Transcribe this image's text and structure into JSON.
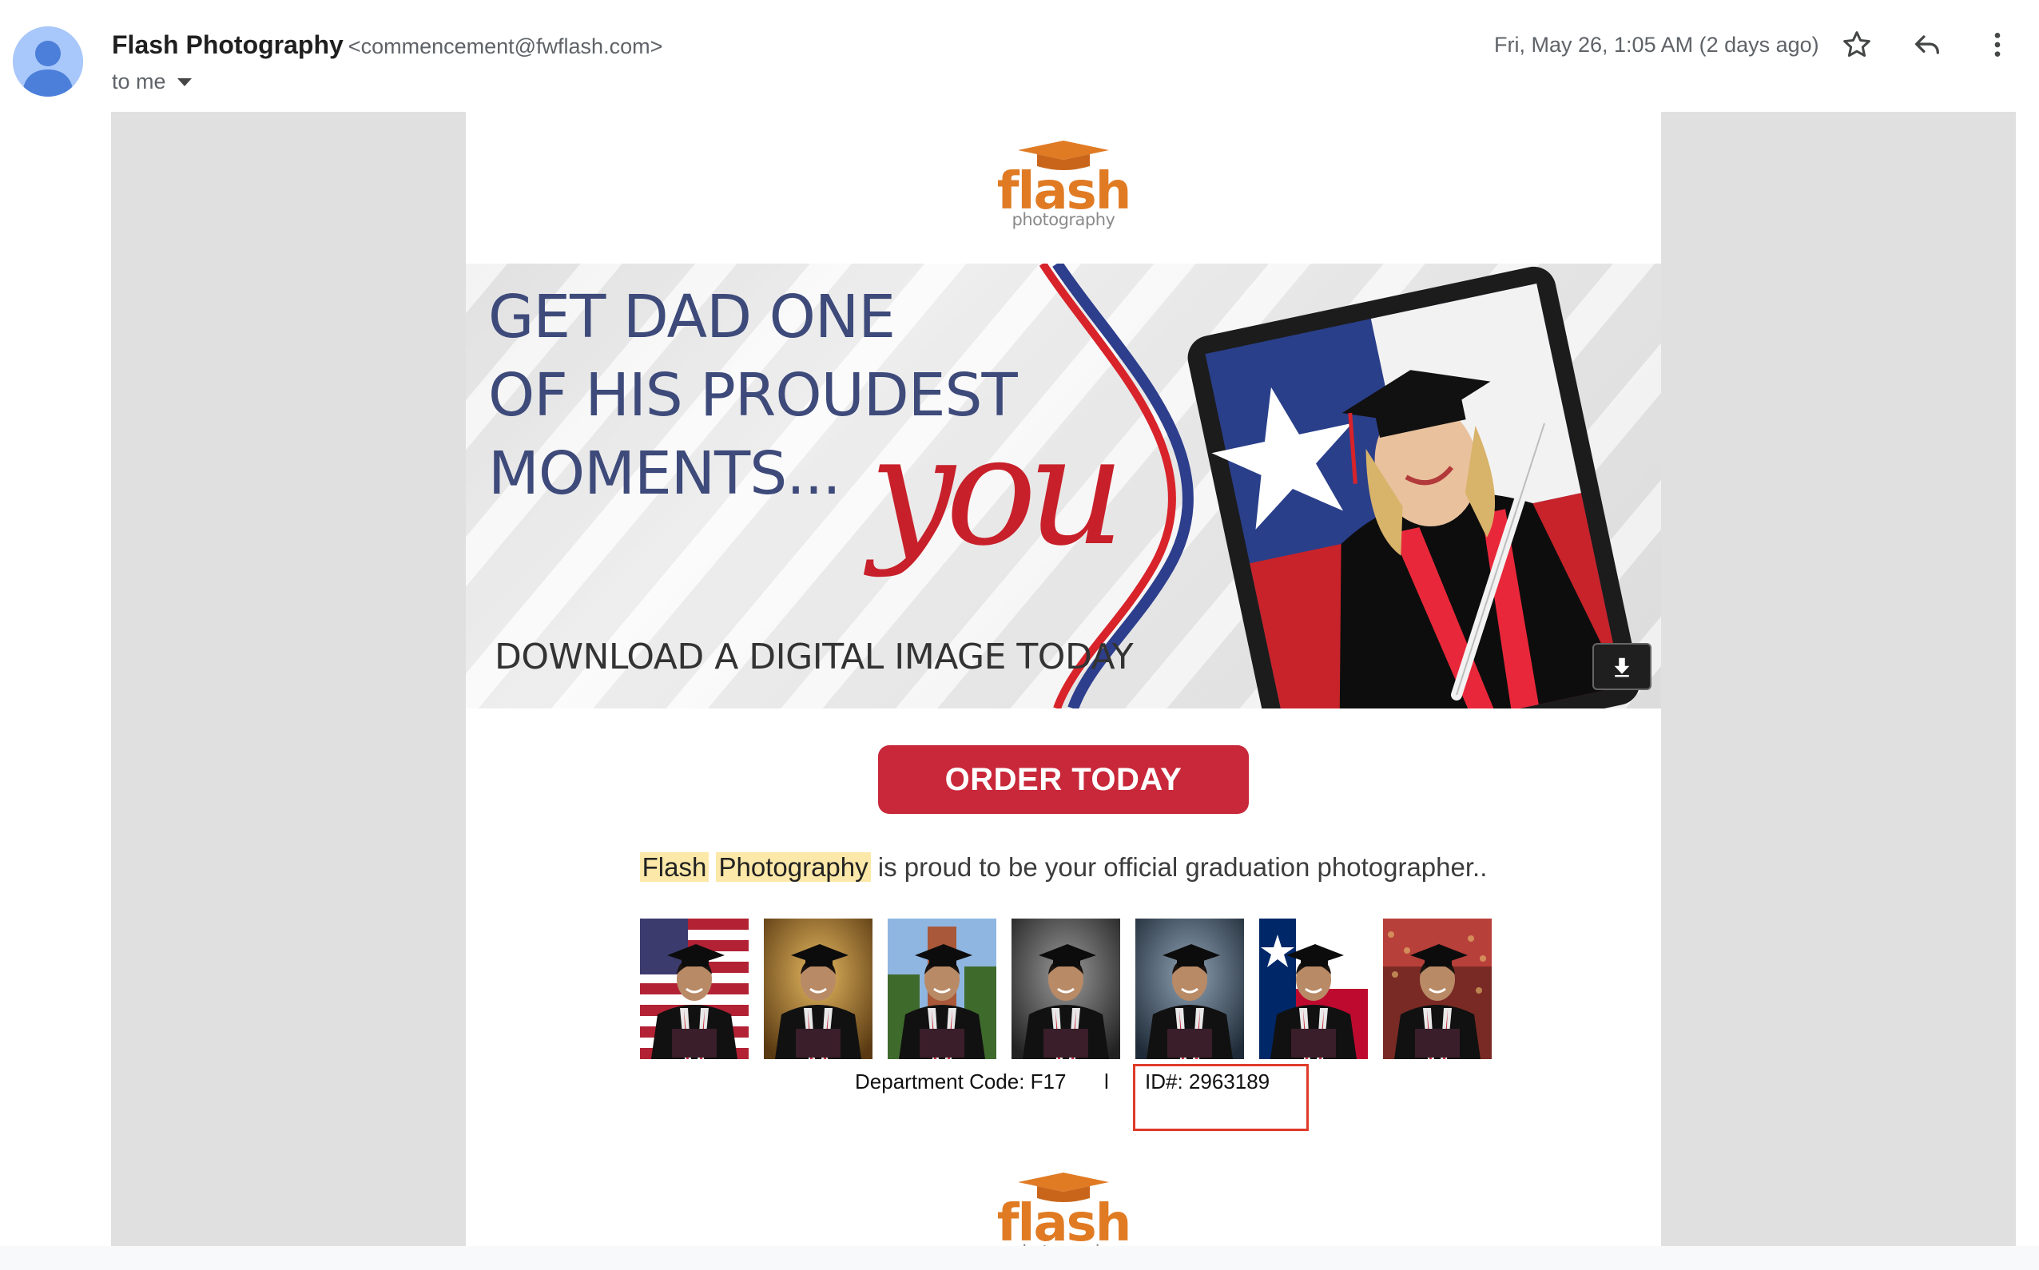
{
  "header": {
    "sender_name": "Flash Photography",
    "sender_email": "<commencement@fwflash.com>",
    "recipient": "to me",
    "date": "Fri, May 26, 1:05 AM (2 days ago)",
    "icons": [
      "star-icon",
      "reply-icon",
      "more-vert-icon"
    ]
  },
  "email": {
    "logo_word": "flash",
    "logo_sub": "photography",
    "banner": {
      "headline_lines": [
        "GET DAD ONE",
        "OF HIS PROUDEST",
        "MOMENTS..."
      ],
      "script_word": "you",
      "tagline": "DOWNLOAD A DIGITAL IMAGE TODAY"
    },
    "order_button": "ORDER TODAY",
    "proud_text": {
      "highlight_1": "Flash",
      "highlight_2": "Photography",
      "rest": " is proud to be your official graduation photographer.."
    },
    "thumbnails": [
      {
        "background": "american-flag"
      },
      {
        "background": "gold-studio"
      },
      {
        "background": "campus-tower"
      },
      {
        "background": "dark-gray-studio"
      },
      {
        "background": "blue-gray-studio"
      },
      {
        "background": "texas-flag"
      },
      {
        "background": "stadium-crowd"
      }
    ],
    "department_code": "Department Code: F17",
    "separator": "l",
    "id_number": "ID#: 2963189"
  },
  "colors": {
    "brand_orange": "#e07b24",
    "order_red": "#c8283a",
    "highlight": "#fce8a8",
    "annotation_red": "#e03a2a"
  }
}
